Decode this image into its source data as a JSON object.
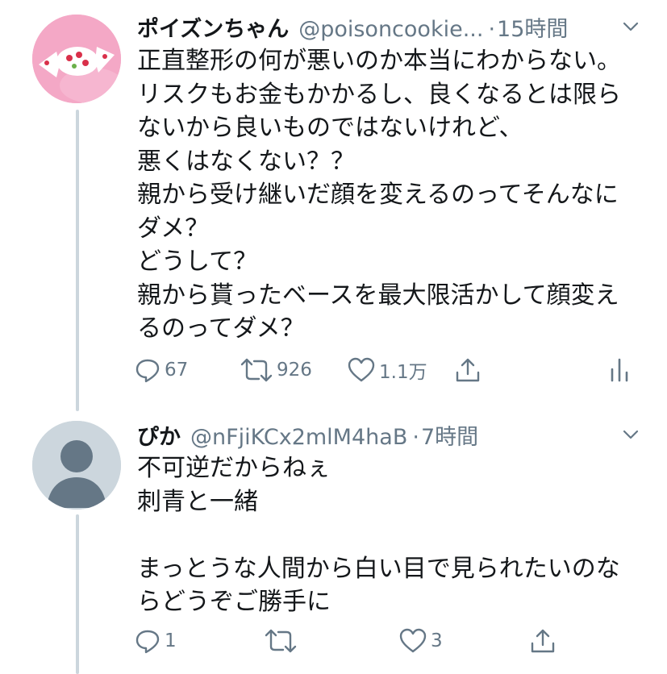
{
  "tweet1": {
    "name": "ポイズンちゃん",
    "handle": "@poisoncookie...",
    "separator": "·",
    "time": "15時間",
    "lines": [
      "正直整形の何が悪いのか本当にわからない。",
      "リスクもお金もかかるし、良くなるとは限ら",
      "ないから良いものではないけれど、",
      "悪くはなくない？？",
      "親から受け継いだ顔を変えるのってそんなに",
      "ダメ？",
      "どうして？",
      "親から貰ったベースを最大限活かして顔変え",
      "るのってダメ？"
    ],
    "replies": "67",
    "retweets": "926",
    "likes": "1.1万",
    "icons": [
      "reply-icon",
      "retweet-icon",
      "like-icon",
      "share-icon",
      "analytics-icon",
      "chevron-down-icon"
    ]
  },
  "tweet2": {
    "name": "ぴか",
    "handle": "@nFjiKCx2mlM4haB",
    "separator": "·",
    "time": "7時間",
    "lines": [
      "不可逆だからねぇ",
      "刺青と一緒",
      "",
      "まっとうな人間から白い目で見られたいのな",
      "らどうぞご勝手に"
    ],
    "replies": "1",
    "likes": "3",
    "icons": [
      "reply-icon",
      "retweet-icon",
      "like-icon",
      "share-icon",
      "chevron-down-icon"
    ]
  },
  "colors": {
    "text": "#14171a",
    "secondary": "#657786",
    "thread_line": "#ccd6dd",
    "avatar_bg": "#ccd6dd",
    "avatar_pink": "#f3a9c7"
  }
}
